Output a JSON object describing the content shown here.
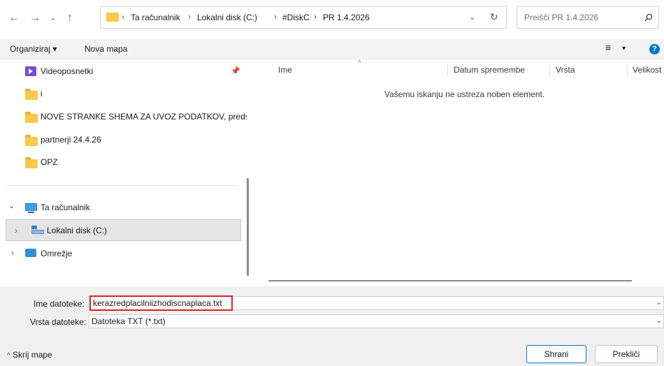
{
  "address": {
    "crumbs": [
      "Ta računalnik",
      "Lokalni disk (C:)",
      "#DiskC",
      "PR 1.4.2026"
    ],
    "search_placeholder": "Preišči PR 1.4.2026"
  },
  "toolbar": {
    "organize": "Organiziraj",
    "new_folder": "Nova mapa"
  },
  "nav": {
    "quick_items": [
      {
        "label": "Videoposnetki"
      },
      {
        "label": "i"
      },
      {
        "label": "NOVE STRANKE SHEMA ZA UVOZ PODATKOV, predsta"
      },
      {
        "label": "partnerji 24.4.26"
      },
      {
        "label": "OPZ"
      }
    ],
    "this_pc": "Ta računalnik",
    "local_disk": "Lokalni disk (C:)",
    "network": "Omrežje"
  },
  "list": {
    "columns": [
      "Ime",
      "Datum spremembe",
      "Vrsta",
      "Velikost"
    ],
    "empty_message": "Vašemu iskanju ne ustreza noben element."
  },
  "dialog": {
    "filename_label": "Ime datoteke:",
    "filename_value": "kerazredplacilniizhodiscnaplaca.txt",
    "filetype_label": "Vrsta datoteke:",
    "filetype_value": "Datoteka TXT (*.txt)",
    "hide_folders": "Skrij mape",
    "save": "Shrani",
    "cancel": "Prekliči"
  },
  "colors": {
    "highlight_border": "#e02020",
    "selected_row": "#e5e5e5",
    "accent_blue": "#0078d4"
  }
}
